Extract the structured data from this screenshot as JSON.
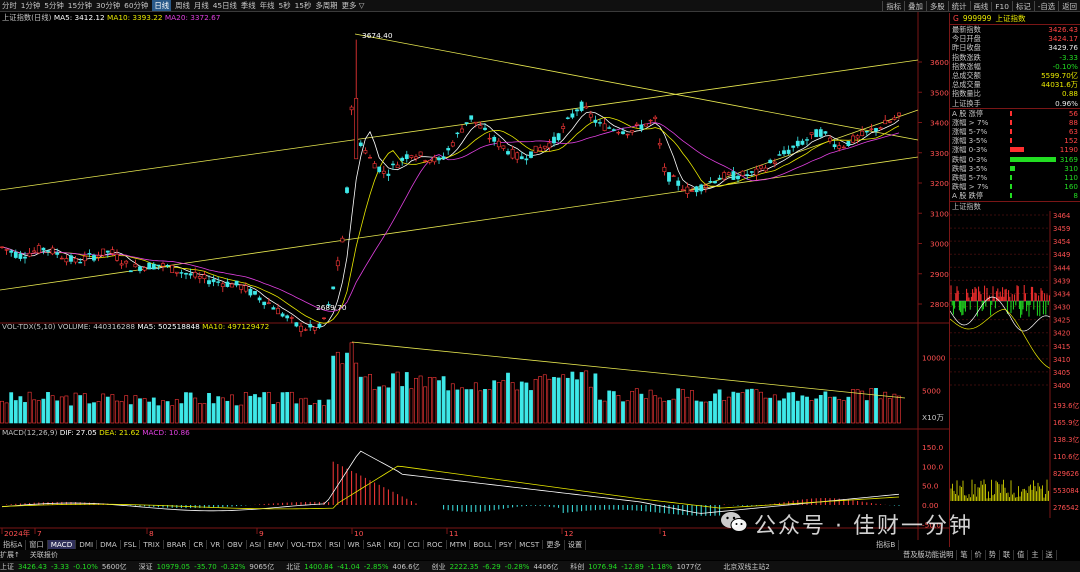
{
  "toolbar": {
    "periods": [
      "1分钟",
      "5分钟",
      "15分钟",
      "30分钟",
      "60分钟",
      "日线",
      "周线",
      "月线",
      "45日线",
      "季线",
      "年线",
      "5秒",
      "15秒",
      "多周期",
      "更多 ▽"
    ],
    "first": "分时",
    "active": "日线",
    "right": [
      "指标",
      "叠加",
      "多股",
      "统计",
      "画线",
      "F10",
      "标记",
      "-自选",
      "返回"
    ]
  },
  "main": {
    "title": "上证指数(日线)",
    "ma5": "MA5: 3412.12",
    "ma10": "MA10: 3393.22",
    "ma20": "MA20: 3372.67",
    "high_label": "3674.40",
    "low_label": "2689.70",
    "yticks": [
      "3600",
      "3500",
      "3400",
      "3300",
      "3200",
      "3100",
      "3000",
      "2900",
      "2800"
    ]
  },
  "volume": {
    "title": "VOL-TDX(5,10)",
    "volume": "VOLUME: 440316288",
    "ma5": "MA5: 502518848",
    "ma10": "MA10: 497129472",
    "yticks": [
      "10000",
      "5000"
    ],
    "unit": "X10万"
  },
  "macd": {
    "title": "MACD(12,26,9)",
    "dif": "DIF: 27.05",
    "dea": "DEA: 21.62",
    "macd": "MACD: 10.86",
    "yticks": [
      "150.0",
      "100.0",
      "50.0",
      "0.00",
      "-50.0"
    ]
  },
  "xaxis": [
    "2024年",
    "7",
    "8",
    "9",
    "10",
    "11",
    "12",
    "1"
  ],
  "indicator_tabs": [
    "指标A",
    "窗口",
    "MACD",
    "DMI",
    "DMA",
    "FSL",
    "TRIX",
    "BRAR",
    "CR",
    "VR",
    "OBV",
    "ASI",
    "EMV",
    "VOL-TDX",
    "RSI",
    "WR",
    "SAR",
    "KDJ",
    "CCI",
    "ROC",
    "MTM",
    "BOLL",
    "PSY",
    "MCST",
    "更多",
    "设置"
  ],
  "indicator_tabs_active": "MACD",
  "indicator_b": "指标B",
  "sub_tabs": [
    "扩展↑",
    "关联报价"
  ],
  "right_panel": {
    "code": "999999",
    "name": "上证指数",
    "g_label": "G",
    "rows": [
      {
        "label": "最新指数",
        "value": "3426.43",
        "color": "red"
      },
      {
        "label": "今日开盘",
        "value": "3424.17",
        "color": "red"
      },
      {
        "label": "昨日收盘",
        "value": "3429.76",
        "color": "wht"
      },
      {
        "label": "指数涨跌",
        "value": "-3.33",
        "color": "grn"
      },
      {
        "label": "指数涨幅",
        "value": "-0.10%",
        "color": "grn"
      },
      {
        "label": "总成交额",
        "value": "5599.70亿",
        "color": "yel"
      },
      {
        "label": "总成交量",
        "value": "44031.6万",
        "color": "yel"
      },
      {
        "label": "指数量比",
        "value": "0.88",
        "color": "yel"
      },
      {
        "label": "上证换手",
        "value": "0.96%",
        "color": "wht"
      }
    ],
    "dist": [
      {
        "label": "A 股 涨停",
        "value": "56",
        "color": "red",
        "frac": 0.02
      },
      {
        "label": "涨幅 > 7%",
        "value": "88",
        "color": "red",
        "frac": 0.03
      },
      {
        "label": "涨幅 5-7%",
        "value": "63",
        "color": "red",
        "frac": 0.02
      },
      {
        "label": "涨幅 3-5%",
        "value": "152",
        "color": "red",
        "frac": 0.05
      },
      {
        "label": "涨幅 0-3%",
        "value": "1190",
        "color": "red",
        "frac": 0.3
      },
      {
        "label": "跌幅 0-3%",
        "value": "3169",
        "color": "grn",
        "frac": 1.0
      },
      {
        "label": "跌幅 3-5%",
        "value": "310",
        "color": "grn",
        "frac": 0.1
      },
      {
        "label": "跌幅 5-7%",
        "value": "110",
        "color": "grn",
        "frac": 0.04
      },
      {
        "label": "跌幅 > 7%",
        "value": "160",
        "color": "grn",
        "frac": 0.05
      },
      {
        "label": "A 股 跌停",
        "value": "8",
        "color": "grn",
        "frac": 0.01
      }
    ],
    "mini_title": "上证指数",
    "mini_yticks": [
      "3464",
      "3459",
      "3454",
      "3449",
      "3444",
      "3439",
      "3434",
      "3430",
      "3425",
      "3420",
      "3415",
      "3410",
      "3405",
      "3400"
    ],
    "mini_vol": [
      "193.6亿",
      "165.9亿",
      "138.3亿",
      "110.6亿",
      "829626",
      "553084",
      "276542"
    ],
    "bottom_tabs": [
      "普及版功能说明",
      "笔",
      "价",
      "势",
      "联",
      "值",
      "主",
      "送"
    ]
  },
  "status": {
    "items": [
      {
        "name": "上证",
        "price": "3426.43",
        "chg": "-3.33",
        "pct": "-0.10%",
        "amt": "5600亿"
      },
      {
        "name": "深证",
        "price": "10979.05",
        "chg": "-35.70",
        "pct": "-0.32%",
        "amt": "9065亿"
      },
      {
        "name": "北证",
        "price": "1400.84",
        "chg": "-41.04",
        "pct": "-2.85%",
        "amt": "406.6亿"
      },
      {
        "name": "创业",
        "price": "2222.35",
        "chg": "-6.29",
        "pct": "-0.28%",
        "amt": "4406亿"
      },
      {
        "name": "科创",
        "price": "1076.94",
        "chg": "-12.89",
        "pct": "-1.18%",
        "amt": "1077亿"
      }
    ],
    "server": "北京双线主站2"
  },
  "watermark": "公众号 · 佳财一分钟",
  "colors": {
    "up": "#ff3a3a",
    "down": "#3ee8e8",
    "ma5": "#ffffff",
    "ma10": "#e8e800",
    "ma20": "#e040e0",
    "trend": "#e8e850"
  }
}
